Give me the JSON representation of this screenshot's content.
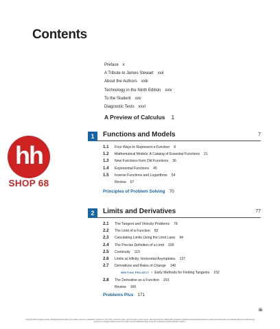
{
  "page_title": "Contents",
  "front_matter": [
    {
      "title": "Preface",
      "page": "x"
    },
    {
      "title": "A Tribute to James Stewart",
      "page": "xxii"
    },
    {
      "title": "About the Authors",
      "page": "xxiii"
    },
    {
      "title": "Technology in the Ninth Edition",
      "page": "xxiv"
    },
    {
      "title": "To the Student",
      "page": "xxv"
    },
    {
      "title": "Diagnostic Tests",
      "page": "xxvi"
    }
  ],
  "preview": {
    "title": "A Preview of Calculus",
    "page": "1"
  },
  "chapter1": {
    "number": "1",
    "title": "Functions and Models",
    "page": "7",
    "sections": [
      {
        "num": "1.1",
        "title": "Four Ways to Represent a Function",
        "page": "8"
      },
      {
        "num": "1.2",
        "title": "Mathematical Models: A Catalog of Essential Functions",
        "page": "21"
      },
      {
        "num": "1.3",
        "title": "New Functions from Old Functions",
        "page": "36"
      },
      {
        "num": "1.4",
        "title": "Exponential Functions",
        "page": "45"
      },
      {
        "num": "1.5",
        "title": "Inverse Functions and Logarithms",
        "page": "54"
      }
    ],
    "review": {
      "title": "Review",
      "page": "67"
    },
    "extra": {
      "title": "Principles of Problem Solving",
      "page": "70"
    }
  },
  "chapter2": {
    "number": "2",
    "title": "Limits and Derivatives",
    "page": "77",
    "sections": [
      {
        "num": "2.1",
        "title": "The Tangent and Velocity Problems",
        "page": "78"
      },
      {
        "num": "2.2",
        "title": "The Limit of a Function",
        "page": "83"
      },
      {
        "num": "2.3",
        "title": "Calculating Limits Using the Limit Laws",
        "page": "94"
      },
      {
        "num": "2.4",
        "title": "The Precise Definition of a Limit",
        "page": "105"
      },
      {
        "num": "2.5",
        "title": "Continuity",
        "page": "115"
      },
      {
        "num": "2.6",
        "title": "Limits at Infinity; Horizontal Asymptotes",
        "page": "127"
      },
      {
        "num": "2.7",
        "title": "Derivatives and Rates of Change",
        "page": "140"
      }
    ],
    "writing_project": {
      "tag": "WRITING PROJECT",
      "bullet": "•",
      "title": "Early Methods for Finding Tangents",
      "page": "152"
    },
    "section_2_8": {
      "num": "2.8",
      "title": "The Derivative as a Function",
      "page": "153"
    },
    "review": {
      "title": "Review",
      "page": "166"
    },
    "extra": {
      "title": "Problems Plus",
      "page": "171"
    }
  },
  "page_number": "iii",
  "copyright": "Copyright 2021 Cengage Learning. All Rights Reserved. May not be copied, scanned, or duplicated, in whole or in part. Due to electronic rights, some third party content may be suppressed from the eBook and/or eChapter(s). Editorial review has deemed that any suppressed content does not materially affect the overall learning experience. Cengage Learning reserves the right to remove additional content at any time if subsequent rights restrictions require it.",
  "watermark": {
    "logo_text": "hh",
    "shop_text": "SHOP 68",
    "color": "#ce2222"
  },
  "colors": {
    "accent": "#1565a6",
    "text": "#231f20"
  }
}
